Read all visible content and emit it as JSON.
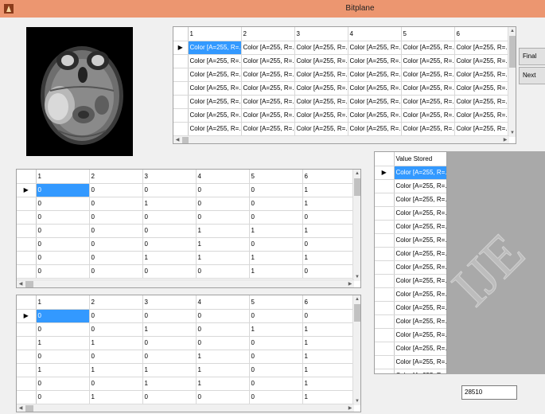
{
  "window": {
    "title": "Bitplane"
  },
  "buttons": {
    "final_label": "Final",
    "next_label": "Next"
  },
  "colorGrid": {
    "columns": [
      "1",
      "2",
      "3",
      "4",
      "5",
      "6"
    ],
    "cell_text": "Color [A=255, R=...",
    "row_count": 7
  },
  "bitGrid1": {
    "columns": [
      "1",
      "2",
      "3",
      "4",
      "5",
      "6"
    ],
    "rows": [
      [
        "0",
        "0",
        "0",
        "0",
        "0",
        "1"
      ],
      [
        "0",
        "0",
        "1",
        "0",
        "0",
        "1"
      ],
      [
        "0",
        "0",
        "0",
        "0",
        "0",
        "0"
      ],
      [
        "0",
        "0",
        "0",
        "1",
        "1",
        "1"
      ],
      [
        "0",
        "0",
        "0",
        "1",
        "0",
        "0"
      ],
      [
        "0",
        "0",
        "1",
        "1",
        "1",
        "1"
      ],
      [
        "0",
        "0",
        "0",
        "0",
        "1",
        "0"
      ]
    ]
  },
  "bitGrid2": {
    "columns": [
      "1",
      "2",
      "3",
      "4",
      "5",
      "6"
    ],
    "rows": [
      [
        "0",
        "0",
        "0",
        "0",
        "0",
        "0"
      ],
      [
        "0",
        "0",
        "1",
        "0",
        "1",
        "1"
      ],
      [
        "1",
        "1",
        "0",
        "0",
        "0",
        "1"
      ],
      [
        "0",
        "0",
        "0",
        "1",
        "0",
        "1"
      ],
      [
        "1",
        "1",
        "1",
        "1",
        "0",
        "1"
      ],
      [
        "0",
        "0",
        "1",
        "1",
        "0",
        "1"
      ],
      [
        "0",
        "1",
        "0",
        "0",
        "0",
        "1"
      ]
    ]
  },
  "valueGrid": {
    "header": "Value Stored",
    "cell_text": "Color [A=255, R=...",
    "row_count": 16,
    "last_partial": "Color [A=255, R=..."
  },
  "watermark": {
    "text": "IJE"
  },
  "result": {
    "value": "28510"
  },
  "colors": {
    "titlebar": "#ec9670",
    "selection": "#3399ff",
    "watermark_bg": "#a9a9a9"
  }
}
